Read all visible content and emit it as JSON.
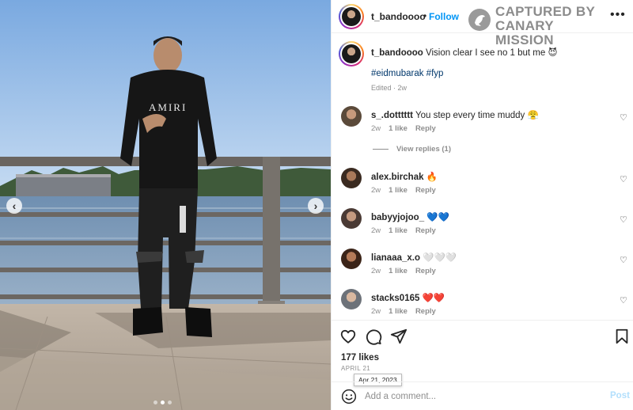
{
  "post": {
    "author": "t_bandoooo",
    "separator": "•",
    "follow_label": "Follow",
    "more_label": "•••",
    "nav_prev": "‹",
    "nav_next": "›",
    "carousel_dots": 3,
    "carousel_active": 1
  },
  "watermark": {
    "line1": "CAPTURED BY",
    "line2": "CANARY MISSION",
    "logo_icon": "canary-bird-icon"
  },
  "caption": {
    "author": "t_bandoooo",
    "text": " Vision clear I see no 1 but me 😈",
    "hashtags": "#eidmubarak #fyp",
    "edited": "Edited · 2w"
  },
  "comments": [
    {
      "user": "s_.dotttttt",
      "text": " You step every time muddy 😤",
      "time": "2w",
      "likes": "1 like",
      "reply": "Reply",
      "avatar_color": "#5b4a3a"
    },
    {
      "user": "alex.birchak",
      "text": " 🔥",
      "time": "2w",
      "likes": "1 like",
      "reply": "Reply",
      "avatar_color": "#6e4a34"
    },
    {
      "user": "babyyjojoo_",
      "text": " 💙💙",
      "time": "2w",
      "likes": "1 like",
      "reply": "Reply",
      "avatar_color": "#7a5c4c"
    },
    {
      "user": "lianaaa_x.o",
      "text": " 🤍🤍🤍",
      "time": "2w",
      "likes": "1 like",
      "reply": "Reply",
      "avatar_color": "#8a5a3e"
    },
    {
      "user": "stacks0165",
      "text": " ❤️❤️",
      "time": "2w",
      "likes": "1 like",
      "reply": "Reply",
      "avatar_color": "#7c8088"
    }
  ],
  "view_replies": "View replies (1)",
  "heart_icon": "♡",
  "likes": "177 likes",
  "date": "APRIL 21",
  "date_tooltip": "Apr 21, 2023",
  "add_comment": {
    "placeholder": "Add a comment...",
    "post_label": "Post"
  },
  "colors": {
    "follow": "#0095f6",
    "hashtag": "#00376b",
    "post_disabled": "#b2dffc",
    "muted": "#8e8e8e"
  }
}
